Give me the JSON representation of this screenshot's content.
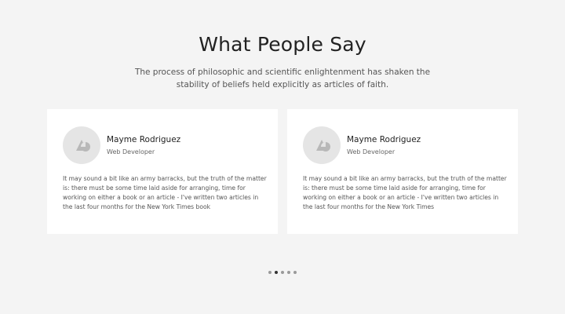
{
  "section": {
    "title": "What People Say",
    "subtitle": "The process of philosophic and scientific enlightenment has shaken the stability of beliefs held explicitly as articles of faith."
  },
  "testimonials": [
    {
      "avatar_icon": "user-avatar-placeholder-icon",
      "name": "Mayme Rodriguez",
      "role": "Web Developer",
      "quote": "It may sound a bit like an army barracks, but the truth of the matter is: there must be some time laid aside for arranging, time for working on either a book or an article - I've written two articles in the last four months for the New York Times book"
    },
    {
      "avatar_icon": "user-avatar-placeholder-icon",
      "name": "Mayme Rodriguez",
      "role": "Web Developer",
      "quote": "It may sound a bit like an army barracks, but the truth of the matter is: there must be some time laid aside for arranging, time for working on either a book or an article - I've written two articles in the last four months for the New York Times"
    }
  ],
  "pagination": {
    "count": 5,
    "active_index": 1
  },
  "colors": {
    "background": "#f4f4f4",
    "card": "#ffffff",
    "avatar_bg": "#e5e5e5",
    "avatar_shape": "#b8b8b8",
    "dot_active": "#333333",
    "dot_inactive": "#999999"
  }
}
